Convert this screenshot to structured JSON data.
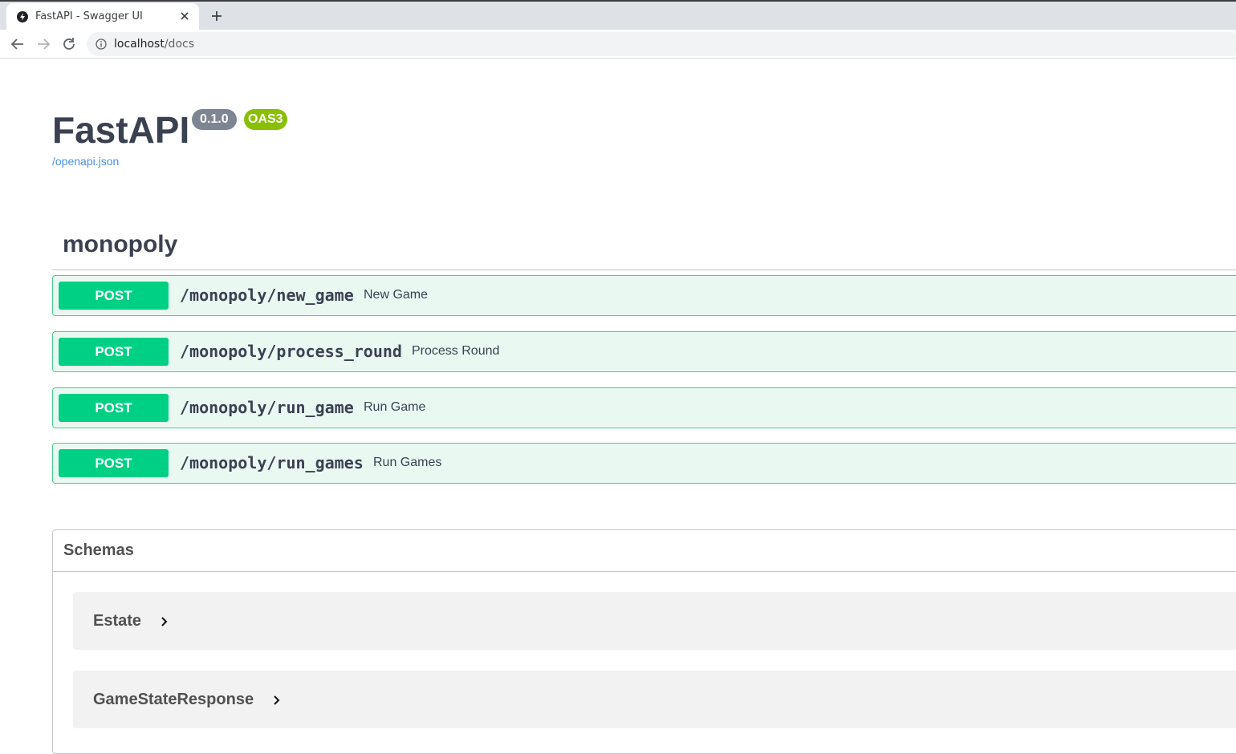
{
  "browser": {
    "tab_title": "FastAPI - Swagger UI",
    "url_host": "localhost",
    "url_path": "/docs"
  },
  "info": {
    "title": "FastAPI",
    "version": "0.1.0",
    "oas_badge": "OAS3",
    "spec_link": "/openapi.json"
  },
  "tag": {
    "name": "monopoly"
  },
  "operations": [
    {
      "method": "POST",
      "path": "/monopoly/new_game",
      "summary": "New Game"
    },
    {
      "method": "POST",
      "path": "/monopoly/process_round",
      "summary": "Process Round"
    },
    {
      "method": "POST",
      "path": "/monopoly/run_game",
      "summary": "Run Game"
    },
    {
      "method": "POST",
      "path": "/monopoly/run_games",
      "summary": "Run Games"
    }
  ],
  "schemas": {
    "title": "Schemas",
    "models": [
      "Estate",
      "GameStateResponse"
    ]
  },
  "colors": {
    "post_method": "#49cc90",
    "title_text": "#3b4151",
    "link": "#4990e2",
    "version_badge": "#7d8492",
    "oas_badge": "#89bf04"
  }
}
